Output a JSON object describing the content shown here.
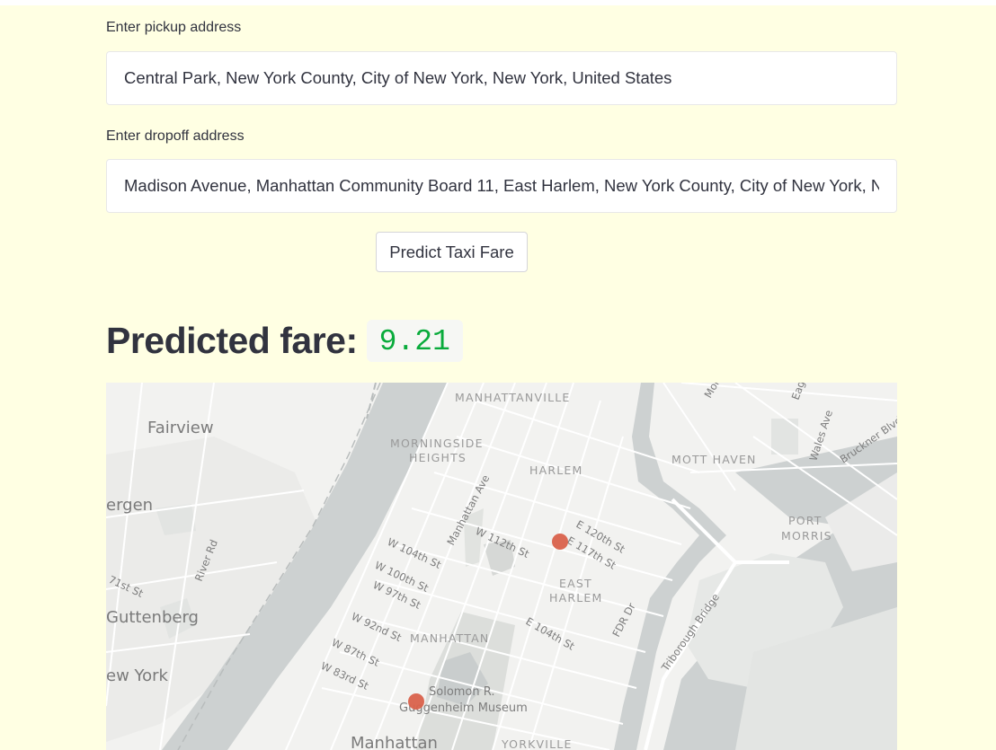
{
  "pickup": {
    "label": "Enter pickup address",
    "value": "Central Park, New York County, City of New York, New York, United States"
  },
  "dropoff": {
    "label": "Enter dropoff address",
    "value": "Madison Avenue, Manhattan Community Board 11, East Harlem, New York County, City of New York, N"
  },
  "predict_button": {
    "label": "Predict Taxi Fare"
  },
  "result": {
    "label": "Predicted fare:",
    "value": "9.21"
  },
  "map": {
    "place_labels": {
      "fairview": "Fairview",
      "bergen": "ergen",
      "guttenberg": "Guttenberg",
      "new_york": "ew York",
      "manhattan_city": "Manhattan"
    },
    "neighborhood_labels": {
      "manhattanville": "MANHATTANVILLE",
      "morningside_1": "MORNINGSIDE",
      "morningside_2": "HEIGHTS",
      "harlem": "HARLEM",
      "mott_haven": "MOTT HAVEN",
      "port_morris_1": "PORT",
      "port_morris_2": "MORRIS",
      "east_harlem_1": "EAST",
      "east_harlem_2": "HARLEM",
      "manhattan": "MANHATTAN",
      "yorkville": "YORKVILLE"
    },
    "street_labels": {
      "river_rd": "River Rd",
      "st_71": "71st St",
      "w104": "W 104th St",
      "w100": "W 100th St",
      "w97": "W 97th St",
      "w92": "W 92nd St",
      "w87": "W 87th St",
      "w83": "W 83rd St",
      "w112": "W 112th St",
      "manhattan_ave": "Manhattan Ave",
      "e120": "E 120th St",
      "e117": "E 117th St",
      "e104": "E 104th St",
      "fdr": "FDR Dr",
      "triborough": "Triborough Bridge",
      "wales": "Wales Ave",
      "bruckner": "Bruckner Blvd",
      "mor": "Mor",
      "eag": "Eag"
    },
    "poi": {
      "guggenheim_1": "Solomon R.",
      "guggenheim_2": "Guggenheim Museum"
    },
    "marker_color": "#d9614b",
    "water_color": "#cdd1d1"
  }
}
